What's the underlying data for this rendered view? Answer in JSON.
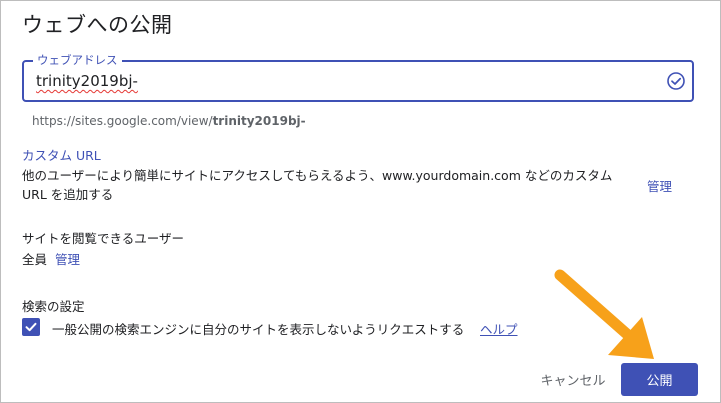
{
  "dialog": {
    "title": "ウェブへの公開",
    "web_address": {
      "label": "ウェブアドレス",
      "value": "trinity2019bj-",
      "url_prefix": "https://sites.google.com/view/",
      "url_suffix": "trinity2019bj-"
    },
    "custom_url": {
      "title": "カスタム URL",
      "description": "他のユーザーにより簡単にサイトにアクセスしてもらえるよう、www.yourdomain.com などのカスタム URL を追加する",
      "manage_label": "管理"
    },
    "viewers": {
      "title": "サイトを閲覧できるユーザー",
      "value": "全員",
      "manage_label": "管理"
    },
    "search": {
      "title": "検索の設定",
      "checkbox_label": "一般公開の検索エンジンに自分のサイトを表示しないようリクエストする",
      "checked": true,
      "help_label": "ヘルプ"
    },
    "buttons": {
      "cancel": "キャンセル",
      "publish": "公開"
    }
  },
  "colors": {
    "accent": "#3f51b5",
    "annotation_arrow": "#f7a11a"
  }
}
